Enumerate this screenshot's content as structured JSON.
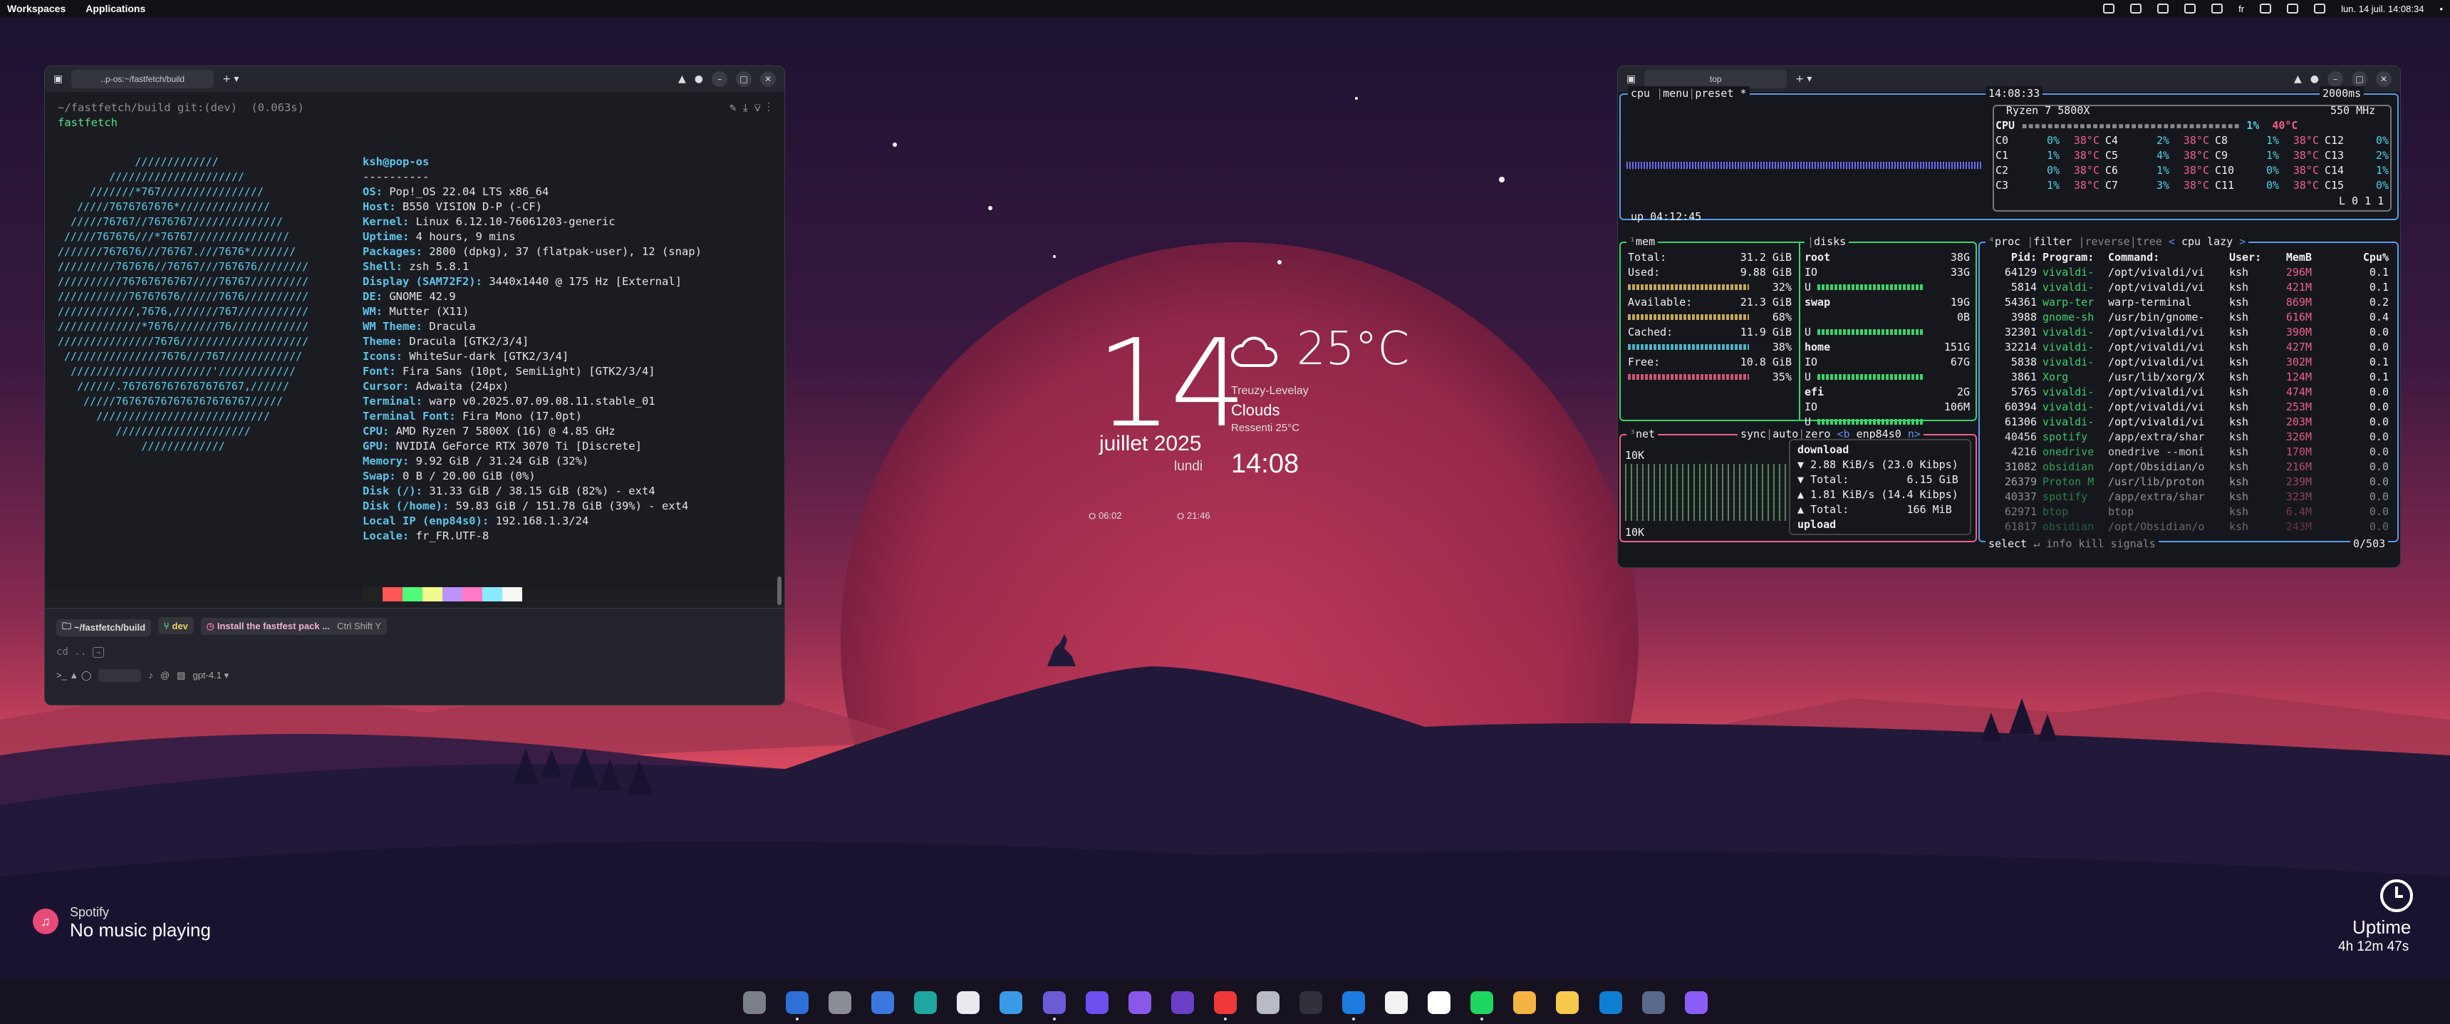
{
  "topbar": {
    "workspaces": "Workspaces",
    "applications": "Applications",
    "lang": "fr",
    "datetime": "lun. 14 juil.  14:08:34"
  },
  "terminal": {
    "tab_title": "..p-os:~/fastfetch/build",
    "cwd_line": "~/fastfetch/build git:(dev)",
    "elapsed": "(0.063s)",
    "command": "fastfetch",
    "ascii": [
      "            /////////////",
      "        /////////////////////",
      "     ///////*767////////////////",
      "   /////7676767676*//////////////",
      "  /////76767//7676767//////////////",
      " /////767676///*76767///////////////",
      "///////767676///76767.///7676*///////",
      "/////////767676//76767///767676////////",
      "//////////76767676767////76767/////////",
      "///////////76767676//////7676//////////",
      "////////////,7676,///////767///////////",
      "/////////////*7676///////76////////////",
      "///////////////7676////////////////////",
      " ///////////////7676///767////////////",
      "  //////////////////////'////////////",
      "   //////.7676767676767676767,//////",
      "    /////767676767676767676767/////",
      "      ///////////////////////////",
      "         /////////////////////",
      "             /////////////"
    ],
    "info": [
      {
        "k": "ksh@pop-os",
        "v": ""
      },
      {
        "k": "",
        "v": "----------"
      },
      {
        "k": "OS:",
        "v": " Pop!_OS 22.04 LTS x86_64"
      },
      {
        "k": "Host:",
        "v": " B550 VISION D-P (-CF)"
      },
      {
        "k": "Kernel:",
        "v": " Linux 6.12.10-76061203-generic"
      },
      {
        "k": "Uptime:",
        "v": " 4 hours, 9 mins"
      },
      {
        "k": "Packages:",
        "v": " 2800 (dpkg), 37 (flatpak-user), 12 (snap)"
      },
      {
        "k": "Shell:",
        "v": " zsh 5.8.1"
      },
      {
        "k": "Display (SAM72F2):",
        "v": " 3440x1440 @ 175 Hz [External]"
      },
      {
        "k": "DE:",
        "v": " GNOME 42.9"
      },
      {
        "k": "WM:",
        "v": " Mutter (X11)"
      },
      {
        "k": "WM Theme:",
        "v": " Dracula"
      },
      {
        "k": "Theme:",
        "v": " Dracula [GTK2/3/4]"
      },
      {
        "k": "Icons:",
        "v": " WhiteSur-dark [GTK2/3/4]"
      },
      {
        "k": "Font:",
        "v": " Fira Sans (10pt, SemiLight) [GTK2/3/4]"
      },
      {
        "k": "Cursor:",
        "v": " Adwaita (24px)"
      },
      {
        "k": "Terminal:",
        "v": " warp v0.2025.07.09.08.11.stable_01"
      },
      {
        "k": "Terminal Font:",
        "v": " Fira Mono (17.0pt)"
      },
      {
        "k": "CPU:",
        "v": " AMD Ryzen 7 5800X (16) @ 4.85 GHz"
      },
      {
        "k": "GPU:",
        "v": " NVIDIA GeForce RTX 3070 Ti [Discrete]"
      },
      {
        "k": "Memory:",
        "v": " 9.92 GiB / 31.24 GiB (32%)"
      },
      {
        "k": "Swap:",
        "v": " 0 B / 20.00 GiB (0%)"
      },
      {
        "k": "Disk (/):",
        "v": " 31.33 GiB / 38.15 GiB (82%) - ext4"
      },
      {
        "k": "Disk (/home):",
        "v": " 59.83 GiB / 151.78 GiB (39%) - ext4"
      },
      {
        "k": "Local IP (enp84s0):",
        "v": " 192.168.1.3/24"
      },
      {
        "k": "Locale:",
        "v": " fr_FR.UTF-8"
      }
    ],
    "swatches": [
      "#222222",
      "#ff5555",
      "#50fa7b",
      "#f1fa8c",
      "#bd93f9",
      "#ff79c6",
      "#8be9fd",
      "#f8f8f2"
    ],
    "chip_path": "~/fastfetch/build",
    "chip_branch": "dev",
    "chip_suggest": "Install the fastfest pack ...",
    "chip_shortcut": "Ctrl Shift Y",
    "input_ghost": "cd ..",
    "model": "gpt-4.1"
  },
  "btop": {
    "tab_title": "top",
    "cpu_tabs": [
      "cpu",
      "menu",
      "preset *"
    ],
    "time": "14:08:33",
    "interval": "2000ms",
    "cpu_name": "Ryzen 7 5800X",
    "freq": "550 MHz",
    "cpu_total": {
      "pct": "1%",
      "temp": "40°C"
    },
    "cores": [
      [
        "C0",
        "0%",
        "38°C",
        "C4",
        "2%",
        "38°C",
        "C8",
        "1%",
        "38°C",
        "C12",
        "0%",
        "38°C"
      ],
      [
        "C1",
        "1%",
        "38°C",
        "C5",
        "4%",
        "38°C",
        "C9",
        "1%",
        "38°C",
        "C13",
        "2%",
        "38°C"
      ],
      [
        "C2",
        "0%",
        "38°C",
        "C6",
        "1%",
        "38°C",
        "C10",
        "0%",
        "38°C",
        "C14",
        "1%",
        "38°C"
      ],
      [
        "C3",
        "1%",
        "38°C",
        "C7",
        "3%",
        "38°C",
        "C11",
        "0%",
        "38°C",
        "C15",
        "0%",
        "38°C"
      ]
    ],
    "load": "L 0 1 1",
    "uptime": "up 04:12:45",
    "mem": {
      "title": "mem",
      "rows": [
        [
          "Total:",
          "31.2 GiB"
        ],
        [
          "Used:",
          "9.88 GiB"
        ],
        [
          "",
          "32%"
        ],
        [
          "Available:",
          "21.3 GiB"
        ],
        [
          "",
          "68%"
        ],
        [
          "Cached:",
          "11.9 GiB"
        ],
        [
          "",
          "38%"
        ],
        [
          "Free:",
          "10.8 GiB"
        ],
        [
          "",
          "35%"
        ]
      ]
    },
    "disks": {
      "title": "disks",
      "items": [
        {
          "name": "root",
          "size": "38G",
          "io": "IO",
          "v": "33G"
        },
        {
          "name": "swap",
          "size": "19G",
          "io": "",
          "v": "0B"
        },
        {
          "name": "home",
          "size": "151G",
          "io": "IO",
          "v": "67G"
        },
        {
          "name": "efi",
          "size": "2G",
          "io": "IO",
          "v": "106M"
        }
      ]
    },
    "net": {
      "title": "net",
      "sync": "sync",
      "auto": "auto",
      "zero": "zero",
      "iface": "enp84s0",
      "scale_top": "10K",
      "scale_bot": "10K",
      "download": "download",
      "dl_rate": "2.88 KiB/s (23.0 Kibps)",
      "dl_total": "6.15 GiB",
      "ul_rate": "1.81 KiB/s (14.4 Kibps)",
      "ul_total": "166 MiB",
      "upload": "upload",
      "total_label": "Total:"
    },
    "proc": {
      "title": "proc",
      "filter": "filter",
      "reverse": "reverse",
      "tree": "tree",
      "cpu_lazy": "cpu lazy",
      "headers": [
        "Pid:",
        "Program:",
        "Command:",
        "User:",
        "MemB",
        "Cpu%"
      ],
      "rows": [
        [
          "64129",
          "vivaldi-",
          "/opt/vivaldi/vi",
          "ksh",
          "296M",
          "0.1"
        ],
        [
          "5814",
          "vivaldi-",
          "/opt/vivaldi/vi",
          "ksh",
          "421M",
          "0.1"
        ],
        [
          "54361",
          "warp-ter",
          "warp-terminal",
          "ksh",
          "869M",
          "0.2"
        ],
        [
          "3988",
          "gnome-sh",
          "/usr/bin/gnome-",
          "ksh",
          "616M",
          "0.4"
        ],
        [
          "32301",
          "vivaldi-",
          "/opt/vivaldi/vi",
          "ksh",
          "390M",
          "0.0"
        ],
        [
          "32214",
          "vivaldi-",
          "/opt/vivaldi/vi",
          "ksh",
          "427M",
          "0.0"
        ],
        [
          "5838",
          "vivaldi-",
          "/opt/vivaldi/vi",
          "ksh",
          "302M",
          "0.1"
        ],
        [
          "3861",
          "Xorg",
          "/usr/lib/xorg/X",
          "ksh",
          "124M",
          "0.1"
        ],
        [
          "5765",
          "vivaldi-",
          "/opt/vivaldi/vi",
          "ksh",
          "474M",
          "0.0"
        ],
        [
          "60394",
          "vivaldi-",
          "/opt/vivaldi/vi",
          "ksh",
          "253M",
          "0.0"
        ],
        [
          "61306",
          "vivaldi-",
          "/opt/vivaldi/vi",
          "ksh",
          "203M",
          "0.0"
        ],
        [
          "40456",
          "spotify",
          "/app/extra/shar",
          "ksh",
          "326M",
          "0.0"
        ],
        [
          "4216",
          "onedrive",
          "onedrive --moni",
          "ksh",
          "170M",
          "0.0"
        ],
        [
          "31082",
          "obsidian",
          "/opt/Obsidian/o",
          "ksh",
          "216M",
          "0.0"
        ],
        [
          "26379",
          "Proton M",
          "/usr/lib/proton",
          "ksh",
          "239M",
          "0.0"
        ],
        [
          "40337",
          "spotify",
          "/app/extra/shar",
          "ksh",
          "323M",
          "0.0"
        ],
        [
          "62971",
          "btop",
          "btop",
          "ksh",
          "6.4M",
          "0.0"
        ],
        [
          "61817",
          "obsidian",
          "/opt/Obsidian/o",
          "ksh",
          "243M",
          "0.0"
        ]
      ],
      "footer_select": "select",
      "footer_info": "info",
      "footer_kill": "kill",
      "footer_signals": "signals",
      "count": "0/503"
    }
  },
  "clock": {
    "day": "14",
    "month_year": "juillet 2025",
    "weekday": "lundi",
    "time": "14:08",
    "sunrise": "06:02",
    "sunset": "21:46"
  },
  "weather": {
    "temp": "25°C",
    "location": "Treuzy-Levelay",
    "condition": "Clouds",
    "feels": "Ressenti 25°C"
  },
  "spotify": {
    "app": "Spotify",
    "status": "No music playing"
  },
  "uptime": {
    "label": "Uptime",
    "value": "4h 12m 47s"
  },
  "dock": {
    "icons": [
      "rocket-icon",
      "files-icon",
      "settings-icon",
      "store-icon",
      "code-icon",
      "camera-icon",
      "folder-icon",
      "notes-icon",
      "vpn-icon",
      "proton-icon",
      "obsidian-icon",
      "vivaldi-icon",
      "screenshot-icon",
      "terminal-icon",
      "mail-icon",
      "notion-icon",
      "calendar-icon",
      "spotify-icon",
      "warp-icon",
      "text-editor-icon",
      "vscode-icon",
      "monitor-icon",
      "downloads-icon"
    ],
    "colors": [
      "#7a7f88",
      "#2e6fd8",
      "#8a8d94",
      "#3a78e0",
      "#1ea7a0",
      "#e9e9f0",
      "#3b9ae8",
      "#6b5bd6",
      "#6e4ff0",
      "#8a58e8",
      "#6c3ec8",
      "#ef3939",
      "#b8bac4",
      "#30313a",
      "#1d7be0",
      "#f2f2f2",
      "#ffffff",
      "#1ed760",
      "#f5b342",
      "#f7c94c",
      "#0f7fd1",
      "#5a6a8c",
      "#8b5cf6"
    ],
    "running": [
      false,
      true,
      false,
      false,
      false,
      false,
      false,
      true,
      false,
      false,
      false,
      true,
      false,
      false,
      true,
      false,
      false,
      true,
      false,
      false,
      false,
      false,
      false
    ]
  }
}
